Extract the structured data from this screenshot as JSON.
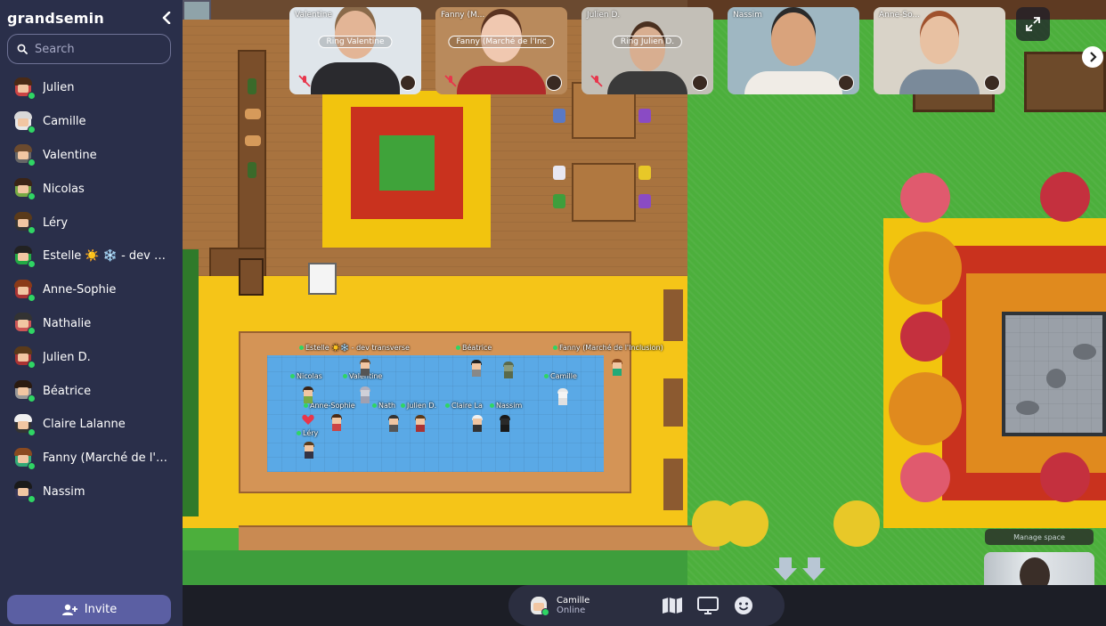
{
  "sidebar": {
    "space_name": "grandsemin",
    "search_placeholder": "Search",
    "users": [
      {
        "name": "Julien",
        "hair": "#4a2a15",
        "shirt": "#c44"
      },
      {
        "name": "Camille",
        "hair": "#d9d9d9",
        "shirt": "#e8e8e8"
      },
      {
        "name": "Valentine",
        "hair": "#6b4a2e",
        "shirt": "#666"
      },
      {
        "name": "Nicolas",
        "hair": "#3a2416",
        "shirt": "#7a4"
      },
      {
        "name": "Léry",
        "hair": "#5a3a1a",
        "shirt": "#333"
      },
      {
        "name": "Estelle ☀️ ❄️  - dev tr...",
        "hair": "#222",
        "shirt": "#2a4"
      },
      {
        "name": "Anne-Sophie",
        "hair": "#8a3a18",
        "shirt": "#a33"
      },
      {
        "name": "Nathalie",
        "hair": "#333",
        "shirt": "#c55"
      },
      {
        "name": "Julien D.",
        "hair": "#5a3a1a",
        "shirt": "#a33"
      },
      {
        "name": "Béatrice",
        "hair": "#2a1a10",
        "shirt": "#999"
      },
      {
        "name": "Claire Lalanne",
        "hair": "#f0f0f0",
        "shirt": "#333"
      },
      {
        "name": "Fanny (Marché de l'In...",
        "hair": "#8a4a20",
        "shirt": "#3a7"
      },
      {
        "name": "Nassim",
        "hair": "#1a1a1a",
        "shirt": "#335"
      }
    ],
    "invite_label": "Invite"
  },
  "video_tiles": [
    {
      "name": "Valentine",
      "ring": "Ring Valentine",
      "muted": true
    },
    {
      "name": "Fanny (M...",
      "ring": "Fanny (Marché de l'Inc",
      "muted": true
    },
    {
      "name": "Julien D.",
      "ring": "Ring Julien D.",
      "muted": true
    },
    {
      "name": "Nassim",
      "ring": "",
      "muted": false
    },
    {
      "name": "Anne-So...",
      "ring": "",
      "muted": false
    }
  ],
  "map_labels": {
    "estelle": "Estelle ☀️❄️ - dev transverse",
    "beatrice": "Béatrice",
    "fanny": "Fanny (Marché de l'Inclusion)",
    "nicolas": "Nicolas",
    "valentine": "Valentine",
    "camille": "Camille",
    "annesophie": "Anne-Sophie",
    "nathalie": "Nath",
    "juliend": "Julien D.",
    "claire": "Claire La",
    "nassim": "Nassim",
    "lery": "Léry"
  },
  "manage_space_label": "Manage space",
  "bottom_bar": {
    "player_name": "Camille",
    "player_status": "Online"
  },
  "colors": {
    "sidebar_bg": "#2a2f4a",
    "online": "#2fd564",
    "invite_bg": "#5b5fa3"
  }
}
